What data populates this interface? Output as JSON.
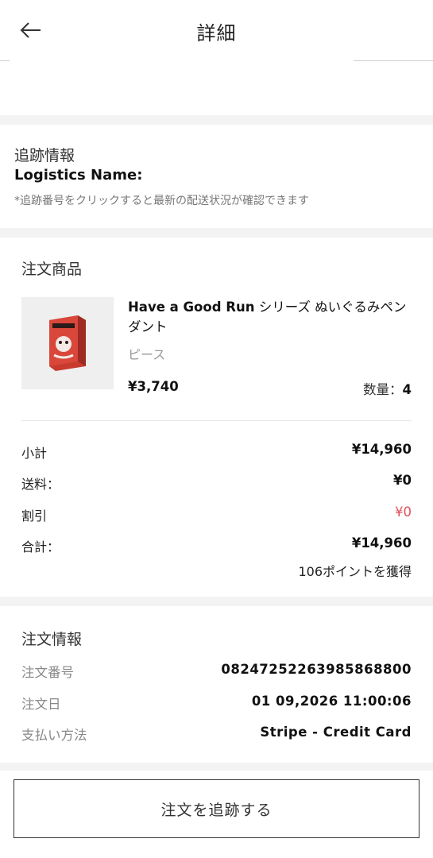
{
  "header": {
    "title": "詳細"
  },
  "tracking": {
    "title": "追跡情報",
    "logistics_name": "Logistics Name:",
    "note": "*追跡番号をクリックすると最新の配送状況が確認できます"
  },
  "order_items": {
    "title": "注文商品",
    "product": {
      "name_en": "Have a Good Run",
      "name_jp": " シリーズ ぬいぐるみペンダント",
      "variant": "ピース",
      "price": "¥3,740",
      "qty_label": "数量：",
      "qty": "4"
    },
    "summary": {
      "subtotal_label": "小計",
      "subtotal": "¥14,960",
      "shipping_label": "送料：",
      "shipping": "¥0",
      "discount_label": "割引",
      "discount": "¥0",
      "total_label": "合計：",
      "total": "¥14,960",
      "points": "106ポイントを獲得"
    }
  },
  "order_info": {
    "title": "注文情報",
    "number_label": "注文番号",
    "number": "08247252263985868800",
    "date_label": "注文日",
    "date": "01 09,2026 11:00:06",
    "payment_label": "支払い方法",
    "payment": "Stripe - Credit Card"
  },
  "actions": {
    "track_order": "注文を追跡する"
  },
  "colors": {
    "discount": "#e0525a",
    "gap": "#f3f3f3",
    "product_box": "#c83a2e"
  },
  "icons": {
    "back": "arrow-left-icon",
    "product": "product-box-image"
  }
}
